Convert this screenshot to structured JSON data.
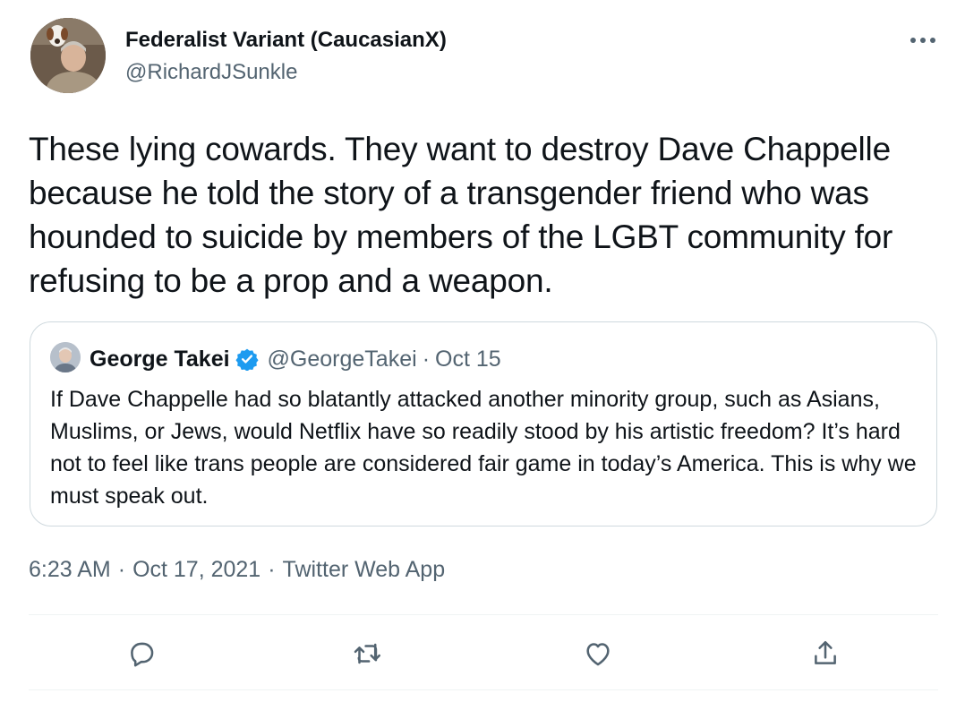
{
  "author": {
    "name": "Federalist Variant (CaucasianX)",
    "handle": "@RichardJSunkle"
  },
  "tweet": {
    "text": "These lying cowards. They want to destroy Dave Chappelle because he told the story of a transgender friend who was hounded to suicide by members of the LGBT community for refusing to be a prop and a weapon."
  },
  "quoted": {
    "name": "George Takei",
    "handle": "@GeorgeTakei",
    "separator": "·",
    "date": "Oct 15",
    "text": "If Dave Chappelle had so blatantly attacked another minority group, such as Asians, Muslims, or Jews, would Netflix have so readily stood by his artistic freedom? It’s hard not to feel like trans people are considered fair game in today’s America. This is why we must speak out."
  },
  "meta": {
    "time": "6:23 AM",
    "date": "Oct 17, 2021",
    "source": "Twitter Web App",
    "separator": "·"
  },
  "icons": {
    "more": "more-horizontal-icon",
    "verified": "verified-badge-icon",
    "reply": "reply-icon",
    "retweet": "retweet-icon",
    "like": "heart-icon",
    "share": "share-icon"
  },
  "colors": {
    "text": "#0f1419",
    "secondary": "#536471",
    "verified": "#1d9bf0",
    "border": "#cfd9de"
  }
}
